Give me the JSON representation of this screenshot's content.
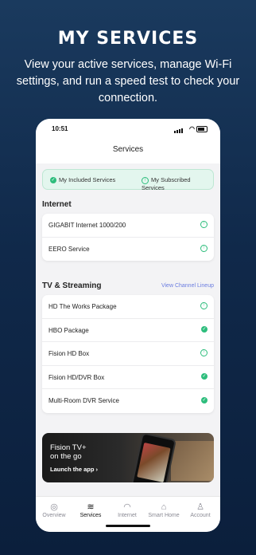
{
  "promo": {
    "title": "MY SERVICES",
    "subtitle": "View your active services, manage Wi-Fi settings, and run a speed test to check your connection."
  },
  "status_bar": {
    "time": "10:51"
  },
  "header": {
    "title": "Services"
  },
  "legend": {
    "included": "My Included Services",
    "subscribed": "My Subscribed Services"
  },
  "internet": {
    "title": "Internet",
    "items": [
      {
        "label": "GIGABIT Internet  1000/200",
        "icon": "upgrade-icon"
      },
      {
        "label": "EERO Service",
        "icon": "upgrade-icon"
      }
    ]
  },
  "tv": {
    "title": "TV & Streaming",
    "link": "View Channel Lineup",
    "items": [
      {
        "label": "HD The Works Package",
        "icon": "upgrade-icon"
      },
      {
        "label": "HBO Package",
        "icon": "check-icon"
      },
      {
        "label": "Fision HD  Box",
        "icon": "upgrade-icon"
      },
      {
        "label": "Fision HD/DVR Box",
        "icon": "check-icon"
      },
      {
        "label": "Multi-Room DVR Service",
        "icon": "check-icon"
      }
    ]
  },
  "banner": {
    "title_line1": "Fision TV+",
    "title_line2": "on the go",
    "cta": "Launch the app  ›"
  },
  "tabs": [
    {
      "label": "Overview",
      "icon": "overview-icon"
    },
    {
      "label": "Services",
      "icon": "layers-icon",
      "active": true
    },
    {
      "label": "Internet",
      "icon": "wifi-icon"
    },
    {
      "label": "Smart Home",
      "icon": "home-icon"
    },
    {
      "label": "Account",
      "icon": "person-icon"
    }
  ],
  "colors": {
    "accent_green": "#2dbd7c",
    "link_blue": "#6b7de0",
    "background_navy": "#10294a"
  }
}
